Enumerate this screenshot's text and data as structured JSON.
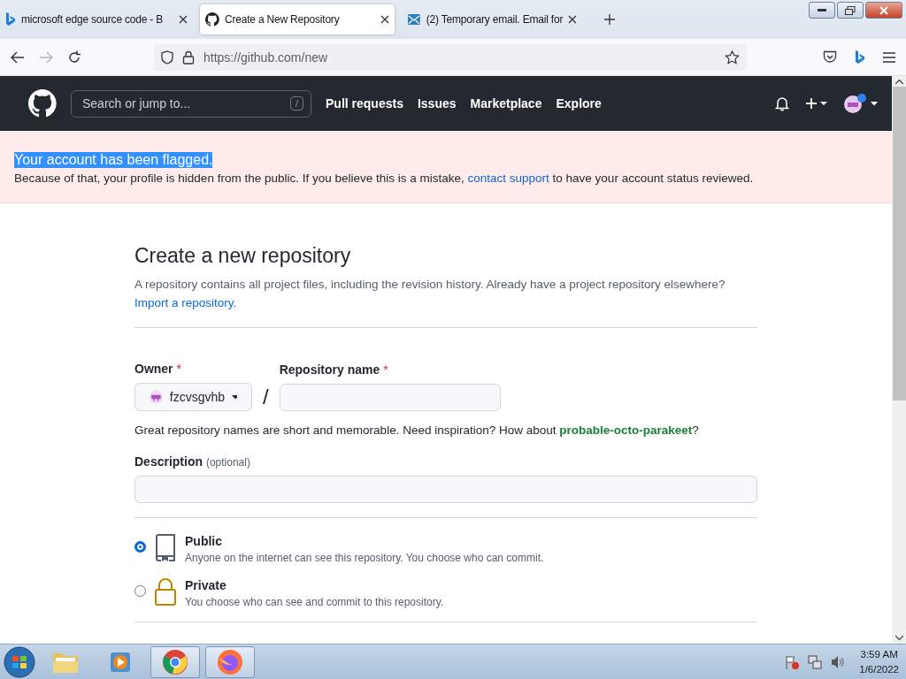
{
  "browser": {
    "tabs": [
      {
        "title": "microsoft edge source code - B",
        "selected": false,
        "kind": "bing"
      },
      {
        "title": "Create a New Repository",
        "selected": true,
        "kind": "github"
      },
      {
        "title": "(2) Temporary email. Email for",
        "selected": false,
        "kind": "mail"
      }
    ],
    "url": "https://github.com/new"
  },
  "header": {
    "search_placeholder": "Search or jump to...",
    "search_key": "/",
    "nav": [
      "Pull requests",
      "Issues",
      "Marketplace",
      "Explore"
    ]
  },
  "flash": {
    "title": "Your account has been flagged.",
    "title_selected": true,
    "message_before": "Because of that, your profile is hidden from the public. If you believe this is a mistake, ",
    "link": "contact support",
    "message_after": " to have your account status reviewed."
  },
  "form": {
    "heading": "Create a new repository",
    "intro": "A repository contains all project files, including the revision history. Already have a project repository elsewhere?",
    "import_link": "Import a repository.",
    "owner_label": "Owner",
    "required_mark": "*",
    "owner": "fzcvsgvhb",
    "separator": "/",
    "repo_label": "Repository name",
    "hint_before": "Great repository names are short and memorable. Need inspiration? How about ",
    "suggestion": "probable-octo-parakeet",
    "hint_after": "?",
    "description_label": "Description",
    "description_optional": "(optional)",
    "visibility": [
      {
        "label": "Public",
        "description": "Anyone on the internet can see this repository. You choose who can commit.",
        "selected": true,
        "kind": "book"
      },
      {
        "label": "Private",
        "description": "You choose who can see and commit to this repository.",
        "selected": false,
        "kind": "lock"
      }
    ]
  },
  "taskbar": {
    "time": "3:59 AM",
    "date": "1/6/2022"
  }
}
